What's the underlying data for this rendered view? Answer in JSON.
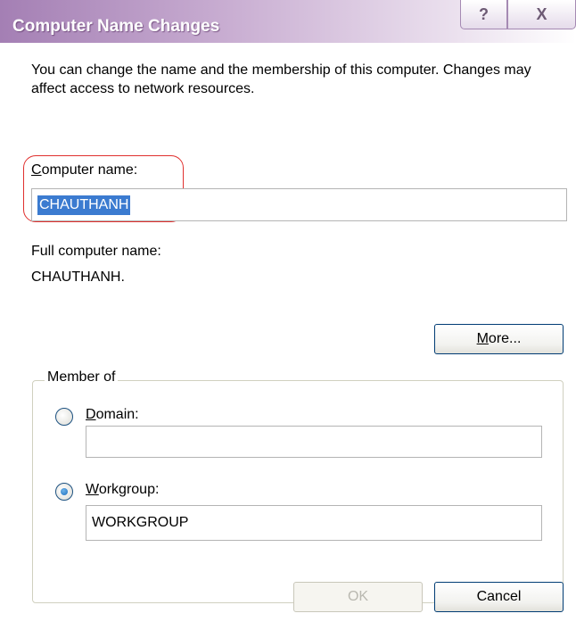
{
  "window": {
    "title": "Computer Name Changes",
    "help_button": "?",
    "close_button": "X"
  },
  "description": "You can change the name and the membership of this computer. Changes may affect access to network resources.",
  "computer_name": {
    "label_accel": "C",
    "label_rest": "omputer name:",
    "value": "CHAUTHANH"
  },
  "full_computer_name": {
    "label": "Full computer name:",
    "value": "CHAUTHANH."
  },
  "more_button": {
    "accel": "M",
    "rest": "ore..."
  },
  "member_of": {
    "title": "Member of",
    "domain": {
      "accel": "D",
      "rest": "omain:",
      "selected": false,
      "value": ""
    },
    "workgroup": {
      "accel": "W",
      "rest": "orkgroup:",
      "selected": true,
      "value": "WORKGROUP"
    }
  },
  "buttons": {
    "ok": "OK",
    "cancel": "Cancel"
  },
  "colors": {
    "selection": "#3b7bd0",
    "annotation": "#e0302e",
    "titlebar": "#a47fb4"
  }
}
